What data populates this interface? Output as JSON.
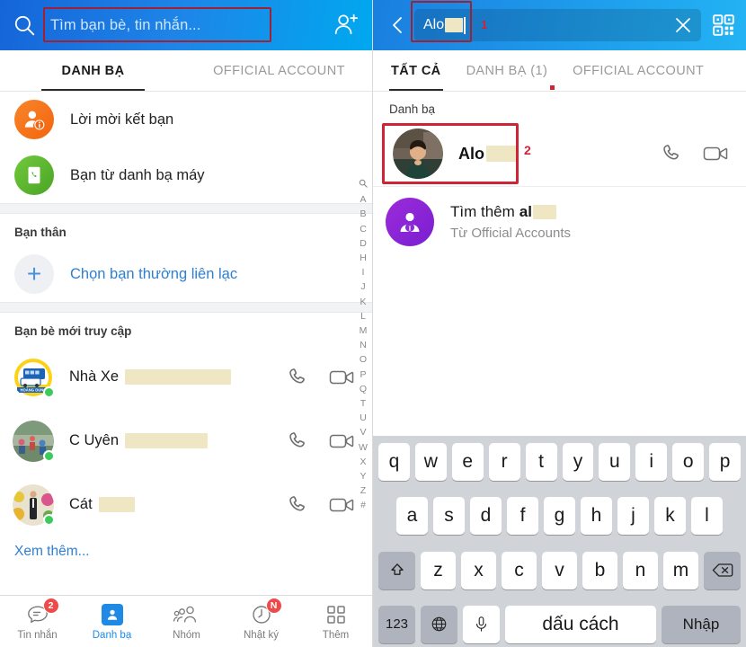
{
  "left": {
    "header": {
      "search_placeholder": "Tìm bạn bè, tin nhắn...",
      "search_icon": "search-icon",
      "add_friend_icon": "add-user-icon"
    },
    "tabs": [
      {
        "label": "DANH BẠ",
        "active": true
      },
      {
        "label": "OFFICIAL ACCOUNT",
        "active": false
      }
    ],
    "quick_rows": [
      {
        "label": "Lời mời kết bạn",
        "icon": "friend-request-icon",
        "color": "#f57c1f"
      },
      {
        "label": "Bạn từ danh bạ máy",
        "icon": "phonebook-icon",
        "color": "#5cb82e"
      }
    ],
    "favorites": {
      "title": "Bạn thân",
      "add_label": "Chọn bạn thường liên lạc"
    },
    "recent": {
      "title": "Bạn bè mới truy cập",
      "contacts": [
        {
          "name": "Nhà Xe",
          "redact_width": 118,
          "online": true,
          "avatar": "bus-logo-avatar"
        },
        {
          "name": "C Uyên",
          "redact_width": 92,
          "online": true,
          "avatar": "group-photo-avatar"
        },
        {
          "name": "Cát",
          "redact_width": 40,
          "online": true,
          "avatar": "man-suit-avatar"
        }
      ],
      "see_more": "Xem thêm..."
    },
    "alphabet_index": [
      "A",
      "B",
      "C",
      "D",
      "H",
      "I",
      "J",
      "K",
      "L",
      "M",
      "N",
      "O",
      "P",
      "Q",
      "T",
      "U",
      "V",
      "W",
      "X",
      "Y",
      "Z",
      "#"
    ],
    "bottom_nav": [
      {
        "label": "Tin nhắn",
        "icon": "message-icon",
        "badge": "2",
        "active": false
      },
      {
        "label": "Danh bạ",
        "icon": "contacts-icon",
        "badge": "",
        "active": true
      },
      {
        "label": "Nhóm",
        "icon": "group-icon",
        "badge": "",
        "active": false
      },
      {
        "label": "Nhật ký",
        "icon": "clock-icon",
        "badge": "N",
        "active": false
      },
      {
        "label": "Thêm",
        "icon": "grid-icon",
        "badge": "",
        "active": false
      }
    ]
  },
  "right": {
    "header": {
      "back_icon": "back-arrow-icon",
      "query_text": "Alo",
      "clear_icon": "close-icon",
      "qr_icon": "qr-code-icon",
      "marker": "1"
    },
    "tabs": [
      {
        "label": "TẤT CẢ",
        "active": true,
        "dot": false
      },
      {
        "label": "DANH BẠ (1)",
        "active": false,
        "dot": true
      },
      {
        "label": "OFFICIAL ACCOUNT",
        "active": false,
        "dot": false
      }
    ],
    "results": {
      "section_title": "Danh bạ",
      "contact": {
        "name": "Alo",
        "redact_width": 34,
        "marker": "2",
        "avatar": "man-photo-avatar"
      },
      "official": {
        "line1_prefix": "Tìm thêm",
        "line1_query": "al",
        "line2": "Từ Official Accounts",
        "icon": "official-account-icon",
        "color": "#8b2bd6"
      }
    },
    "keyboard": {
      "row1": [
        "q",
        "w",
        "e",
        "r",
        "t",
        "y",
        "u",
        "i",
        "o",
        "p"
      ],
      "row2": [
        "a",
        "s",
        "d",
        "f",
        "g",
        "h",
        "j",
        "k",
        "l"
      ],
      "row3": [
        "z",
        "x",
        "c",
        "v",
        "b",
        "n",
        "m"
      ],
      "shift_icon": "shift-icon",
      "backspace_icon": "backspace-icon",
      "numbers_key": "123",
      "globe_icon": "globe-icon",
      "mic_icon": "microphone-icon",
      "space_key": "dấu cách",
      "enter_key": "Nhập"
    }
  },
  "colors": {
    "header_blue_start": "#1565d8",
    "header_blue_end": "#00a8ef",
    "accent_blue": "#1e8ae5",
    "annotation_red": "#cf2338",
    "redaction": "#efe7c4",
    "online_green": "#3ccb5a"
  }
}
